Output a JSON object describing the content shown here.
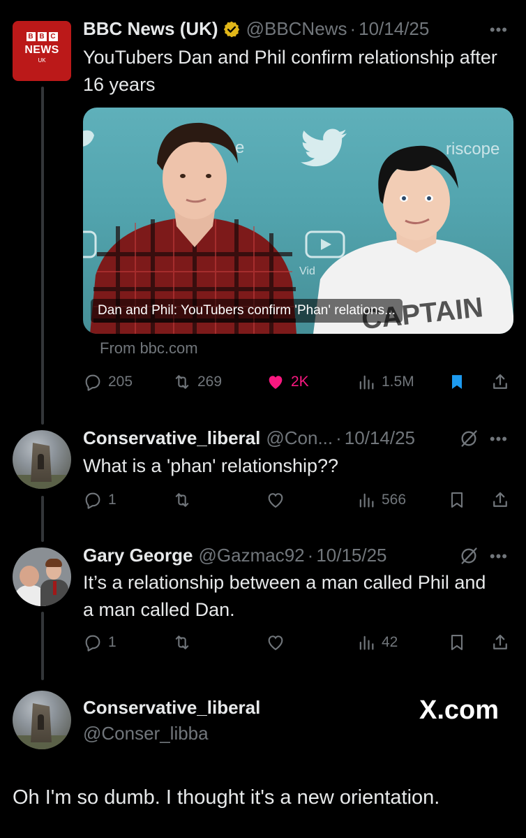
{
  "tweets": {
    "main": {
      "name": "BBC News (UK)",
      "handle": "@BBCNews",
      "date": "10/14/25",
      "text": "YouTubers Dan and Phil confirm relationship after 16 years",
      "avatar": {
        "line1": "BBC",
        "line2": "NEWS",
        "line3": "UK"
      },
      "card": {
        "caption": "Dan and Phil: YouTubers confirm 'Phan' relations...",
        "source": "From bbc.com",
        "backdrop_text_1": "e",
        "backdrop_text_2": "riscope",
        "backdrop_text_3": "Vid"
      },
      "stats": {
        "replies": "205",
        "retweets": "269",
        "likes": "2K",
        "views": "1.5M"
      }
    },
    "reply1": {
      "name": "Conservative_liberal",
      "handle": "@Con...",
      "date": "10/14/25",
      "text": "What is a 'phan' relationship??",
      "stats": {
        "replies": "1",
        "views": "566"
      }
    },
    "reply2": {
      "name": "Gary George",
      "handle": "@Gazmac92",
      "date": "10/15/25",
      "text": "It’s a relationship between a man called Phil and a man called Dan.",
      "stats": {
        "replies": "1",
        "views": "42"
      }
    },
    "quote": {
      "name": "Conservative_liberal",
      "handle": "@Conser_libba",
      "brand": "X.com",
      "text": "Oh I'm so dumb. I thought it's a new orientation."
    }
  },
  "colors": {
    "background": "#000000",
    "text": "#e7e9ea",
    "muted": "#71767b",
    "like_pink": "#f91880",
    "bookmark_blue": "#1d9bf0",
    "verified_gold": "#e2b719",
    "bbc_red": "#bb1919"
  },
  "icons": [
    "reply-icon",
    "retweet-icon",
    "heart-icon",
    "views-icon",
    "bookmark-icon",
    "share-icon",
    "verified-badge-icon",
    "grok-icon",
    "more-icon"
  ]
}
